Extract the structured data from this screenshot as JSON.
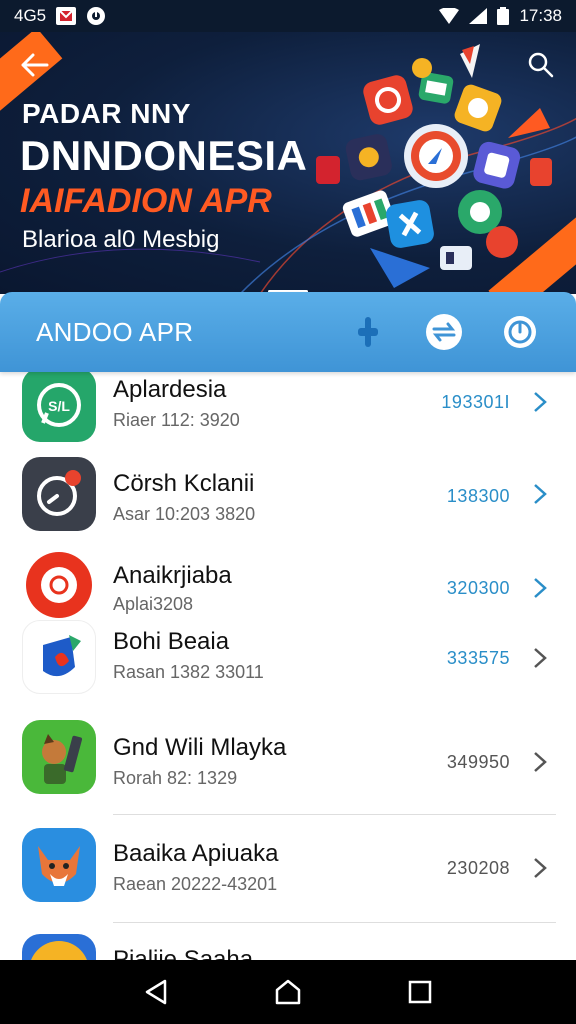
{
  "status_bar": {
    "carrier": "4G5",
    "time": "17:38",
    "icons": [
      "notification-icon",
      "sync-icon",
      "wifi-icon",
      "signal-icon",
      "battery-icon"
    ]
  },
  "hero": {
    "line1": "PADAR NNY",
    "line2": "DNNDONESIA",
    "line3": "IAIFADION APR",
    "line4": "Blarioa al0 Mesbig",
    "accent_color": "#ff5a22",
    "background_color": "#0e1f3c"
  },
  "section": {
    "title": "ANDOO APR",
    "actions": [
      "plus-icon",
      "swap-icon",
      "clock-icon"
    ],
    "color": "#4aa2e0"
  },
  "list": {
    "items": [
      {
        "title": "Aplardesia",
        "subtitle": "Riaer 112: 3920",
        "value": "193301I",
        "icon": "whatsapp-style-icon"
      },
      {
        "title": "Cörsh Kclanii",
        "subtitle": "Asar 10:203 3820",
        "value": "138300",
        "icon": "camera-ring-icon"
      },
      {
        "title": "Anaikrjiaba",
        "subtitle": "Aplai3208",
        "value": "320300",
        "icon": "record-icon"
      },
      {
        "title": "Bohi Beaia",
        "subtitle": "Rasan 1382 33011",
        "value": "333575",
        "icon": "shield-icon"
      },
      {
        "title": "Gnd Wili Mlayka",
        "subtitle": "Rorah 82: 1329",
        "value": "349950",
        "icon": "character-icon"
      },
      {
        "title": "Baaika Apiuaka",
        "subtitle": "Raean 20222-43201",
        "value": "230208",
        "icon": "fox-icon"
      },
      {
        "title": "Pialiie Saaha",
        "subtitle": "",
        "value": "",
        "icon": "globe-icon"
      }
    ]
  },
  "nav": {
    "buttons": [
      "back-triangle-icon",
      "home-icon",
      "recents-icon"
    ]
  }
}
